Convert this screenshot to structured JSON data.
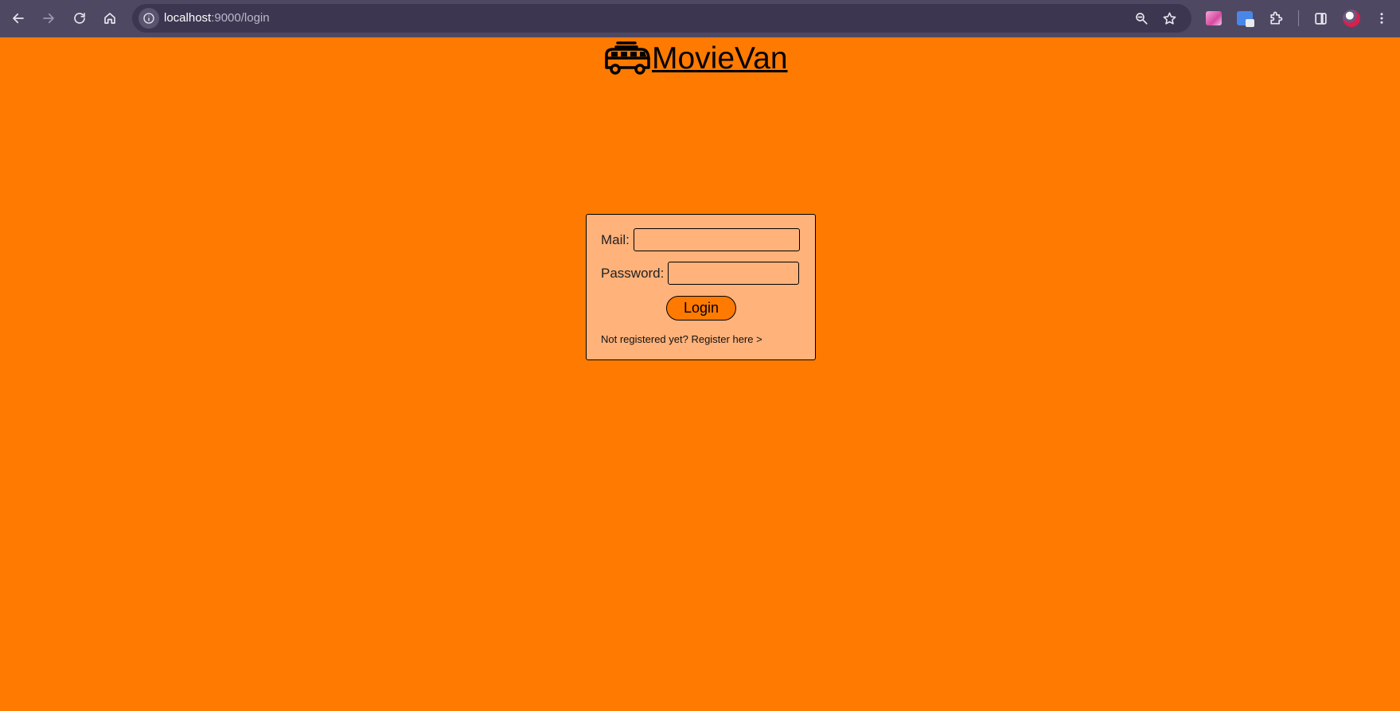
{
  "browser": {
    "url_host": "localhost",
    "url_rest": ":9000/login",
    "nav": [
      "back-icon",
      "forward-icon",
      "reload-icon",
      "home-icon"
    ],
    "omnibox_icons": [
      "site-info-icon",
      "zoom-icon",
      "bookmark-star-icon"
    ],
    "extension_icons": [
      "extension-gradient-icon",
      "google-translate-icon",
      "extensions-puzzle-icon",
      "side-panel-icon",
      "profile-avatar-icon",
      "more-menu-icon"
    ]
  },
  "header": {
    "brand_name": "MovieVan",
    "brand_icon": "van-icon"
  },
  "login_form": {
    "mail_label": "Mail:",
    "mail_value": "",
    "password_label": "Password:",
    "password_value": "",
    "login_button": "Login",
    "register_link": "Not registered yet? Register here >"
  },
  "colors": {
    "page_background": "#ff7a00",
    "form_background": "#ffb27a",
    "browser_chrome": "#4f4862"
  }
}
